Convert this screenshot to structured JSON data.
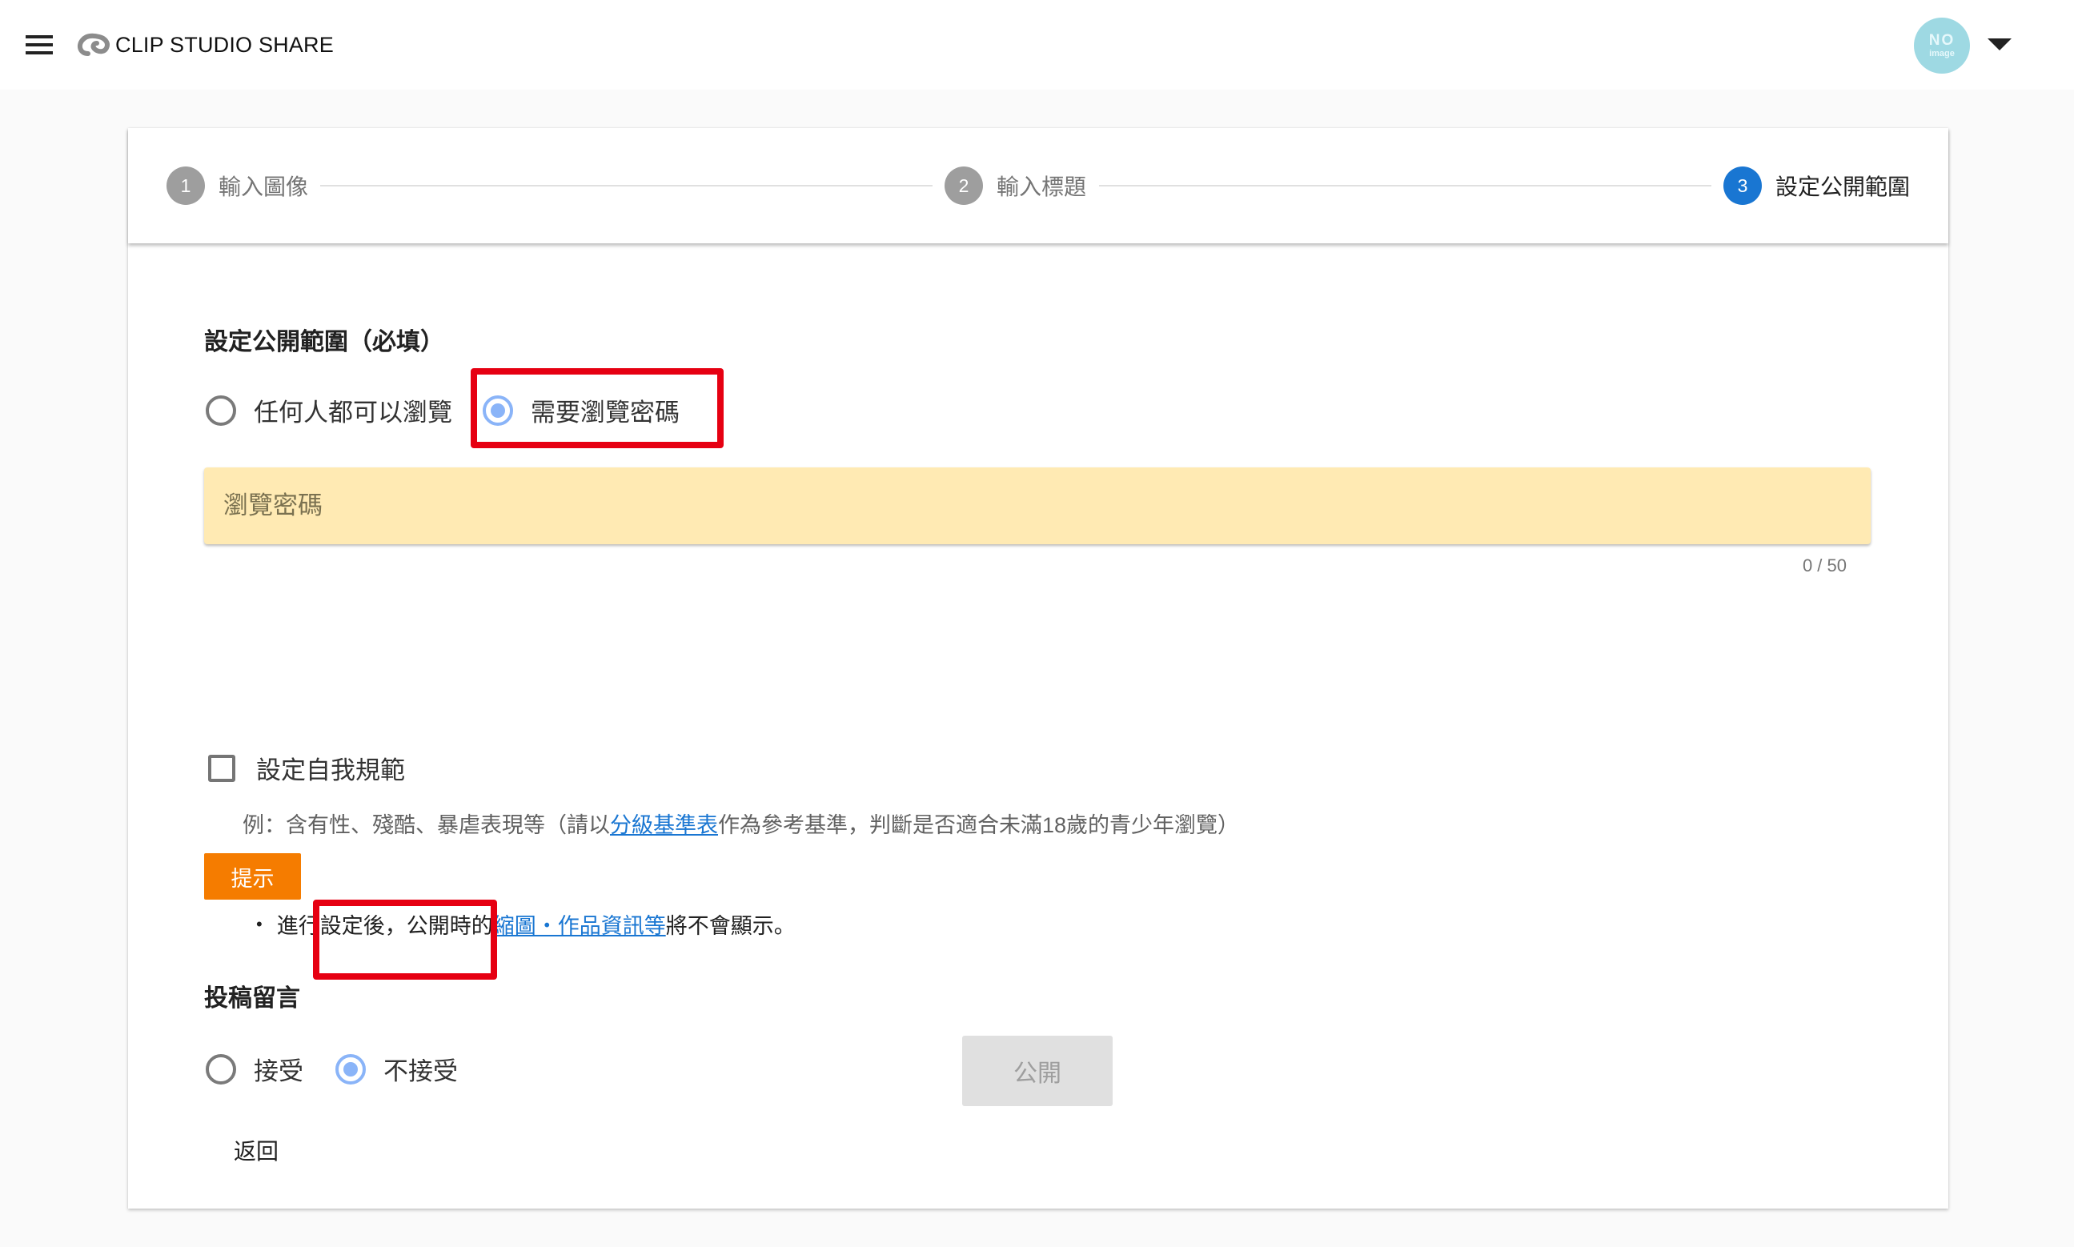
{
  "app": {
    "title": "CLIP STUDIO SHARE",
    "avatar_line1": "NO",
    "avatar_line2": "image"
  },
  "stepper": {
    "steps": [
      {
        "number": "1",
        "label": "輸入圖像",
        "state": "done"
      },
      {
        "number": "2",
        "label": "輸入標題",
        "state": "done"
      },
      {
        "number": "3",
        "label": "設定公開範圍",
        "state": "active"
      }
    ]
  },
  "visibility": {
    "title": "設定公開範圍（必填）",
    "options": [
      {
        "label": "任何人都可以瀏覽",
        "checked": false
      },
      {
        "label": "需要瀏覽密碼",
        "checked": true
      }
    ],
    "password": {
      "value": "",
      "placeholder": "瀏覽密碼",
      "counter": "0 / 50"
    }
  },
  "self_regulation": {
    "checkbox_label": "設定自我規範",
    "checked": false,
    "example_prefix": "例：含有性、殘酷、暴虐表現等（請以",
    "example_link": "分級基準表",
    "example_suffix": "作為參考基準，判斷是否適合未滿18歲的青少年瀏覽）",
    "hint_label": "提示",
    "hint_bullet": "•",
    "hint_prefix": "進行設定後，公開時的",
    "hint_link": "縮圖・作品資訊等",
    "hint_suffix": "將不會顯示。"
  },
  "comments": {
    "title": "投稿留言",
    "options": [
      {
        "label": "接受",
        "checked": false
      },
      {
        "label": "不接受",
        "checked": true
      }
    ]
  },
  "actions": {
    "publish_label": "公開",
    "publish_disabled": true,
    "back_label": "返回"
  },
  "colors": {
    "accent": "#1976d2",
    "radio_checked": "#8ab4f8",
    "highlight_box": "#e60012",
    "password_field_bg": "#ffeab3",
    "hint_badge": "#f57c00",
    "avatar_bg": "#9ed9e3"
  }
}
